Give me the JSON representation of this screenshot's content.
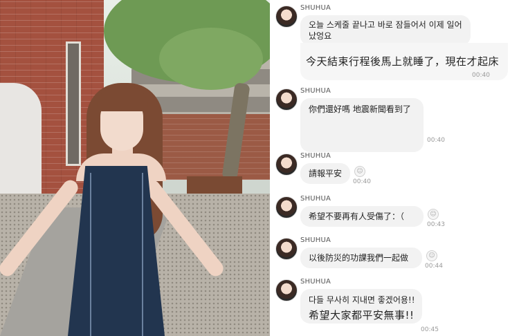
{
  "chat": {
    "messages": [
      {
        "sender": "SHUHUA",
        "lines": [
          "오늘 스케줄 끝나고 바로 잠들어서 이제 일어",
          "났엉요"
        ],
        "caption": "今天結束行程後馬上就睡了，現在才起床",
        "time": "00:40"
      },
      {
        "sender": "SHUHUA",
        "lines": [
          "你們還好嗎 地震新聞看到了"
        ],
        "caption": "",
        "time": "00:40"
      },
      {
        "sender": "SHUHUA",
        "lines": [
          "請報平安"
        ],
        "caption": "",
        "time": "00:40"
      },
      {
        "sender": "SHUHUA",
        "lines": [
          "希望不要再有人受傷了：（"
        ],
        "caption": "",
        "time": "00:43"
      },
      {
        "sender": "SHUHUA",
        "lines": [
          "以後防災的功課我們一起做"
        ],
        "caption": "",
        "time": "00:44"
      },
      {
        "sender": "SHUHUA",
        "lines": [
          "다들 무사히 지내면 좋겠어용!!"
        ],
        "caption": "希望大家都平安無事!!",
        "time": "00:45"
      }
    ],
    "read_icon": "emoji-reaction-icon"
  },
  "colors": {
    "bubble": "#f2f2f2",
    "dress": "#22354f",
    "brick": "#a4513f"
  }
}
